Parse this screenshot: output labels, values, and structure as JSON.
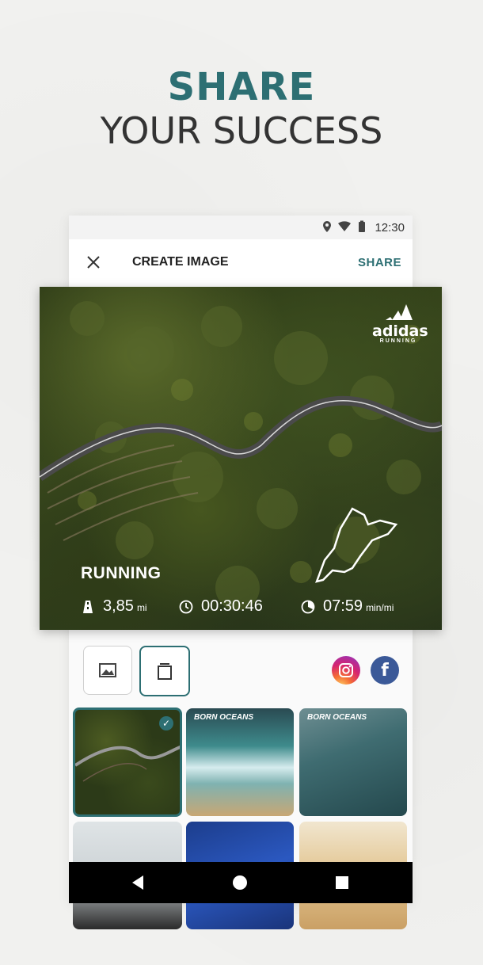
{
  "headline": {
    "line1": "SHARE",
    "line2": "YOUR SUCCESS"
  },
  "status_bar": {
    "time": "12:30",
    "icons": [
      "location-icon",
      "wifi-icon",
      "battery-icon"
    ]
  },
  "app_bar": {
    "close_icon": "close-icon",
    "title": "CREATE IMAGE",
    "share_label": "SHARE"
  },
  "hero": {
    "brand": "adidas",
    "brand_sub": "RUNNING",
    "activity": "RUNNING",
    "stats": [
      {
        "icon": "road-icon",
        "value": "3,85",
        "unit": "mi"
      },
      {
        "icon": "clock-icon",
        "value": "00:30:46",
        "unit": ""
      },
      {
        "icon": "pace-icon",
        "value": "07:59",
        "unit": "min/mi"
      }
    ]
  },
  "controls": {
    "photo_icon": "image-icon",
    "layout_icon": "layout-icon",
    "social": [
      "instagram-icon",
      "facebook-icon"
    ],
    "facebook_glyph": "f"
  },
  "thumbnails": [
    {
      "label": "",
      "selected": true
    },
    {
      "label": "BORN OCEANS",
      "selected": false
    },
    {
      "label": "BORN OCEANS",
      "selected": false
    },
    {
      "label": "",
      "selected": false
    },
    {
      "label": "",
      "selected": false
    },
    {
      "label": "",
      "selected": false
    }
  ],
  "colors": {
    "accent": "#2d6f73",
    "nav_bar": "#000000"
  }
}
